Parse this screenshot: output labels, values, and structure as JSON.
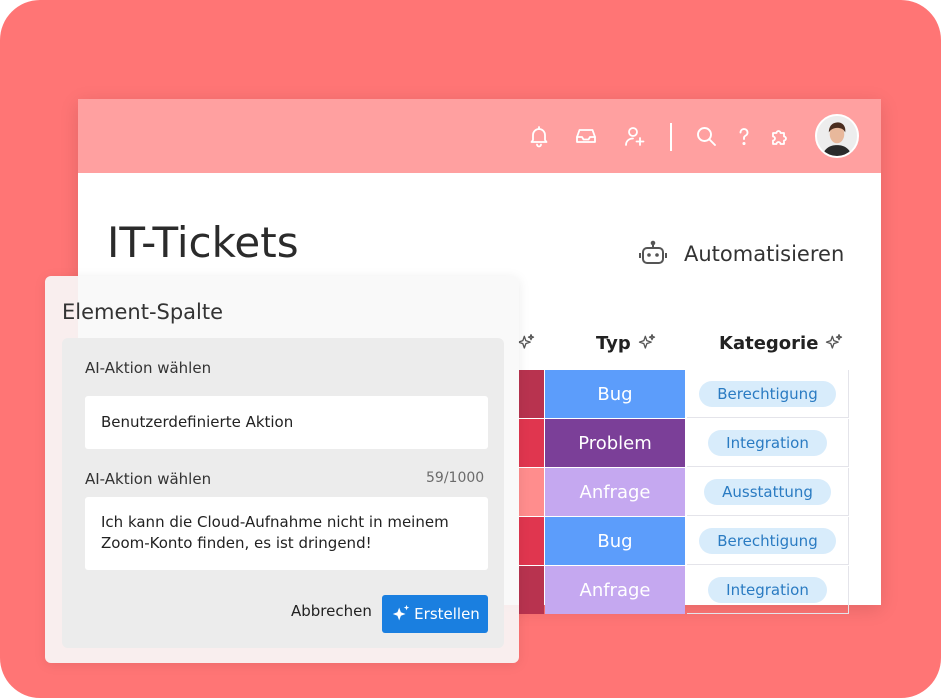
{
  "colors": {
    "background": "#ff7575",
    "topbar": "#ffa0a0",
    "accent": "#1a7fe0",
    "typ_bug": "#5c9dfb",
    "typ_problem": "#7b3f98",
    "typ_anfrage": "#c5a8f0",
    "pill_bg": "#d8ecfb",
    "pill_text": "#2a7bc2"
  },
  "topbar": {
    "icons": [
      "bell-icon",
      "inbox-icon",
      "invite-user-icon",
      "search-icon",
      "help-icon",
      "apps-puzzle-icon"
    ]
  },
  "page": {
    "title": "IT-Tickets",
    "automate_label": "Automatisieren"
  },
  "table": {
    "columns": [
      "Typ",
      "Kategorie"
    ],
    "rows": [
      {
        "stripe": "#b8334f",
        "typ": "Bug",
        "typ_color": "#5c9dfb",
        "kategorie": "Berechtigung"
      },
      {
        "stripe": "#e0364f",
        "typ": "Problem",
        "typ_color": "#7b3f98",
        "kategorie": "Integration"
      },
      {
        "stripe": "#ff8d8d",
        "typ": "Anfrage",
        "typ_color": "#c5a8f0",
        "kategorie": "Ausstattung"
      },
      {
        "stripe": "#e0364f",
        "typ": "Bug",
        "typ_color": "#5c9dfb",
        "kategorie": "Berechtigung"
      },
      {
        "stripe": "#b8334f",
        "typ": "Anfrage",
        "typ_color": "#c5a8f0",
        "kategorie": "Integration"
      }
    ]
  },
  "panel": {
    "title": "Element-Spalte",
    "action_label": "AI-Aktion wählen",
    "action_value": "Benutzerdefinierte Aktion",
    "prompt_label": "AI-Aktion wählen",
    "prompt_counter": "59/1000",
    "prompt_value": "Ich kann die Cloud-Aufnahme nicht in meinem Zoom-Konto finden, es ist dringend!",
    "cancel_label": "Abbrechen",
    "create_label": "Erstellen"
  }
}
